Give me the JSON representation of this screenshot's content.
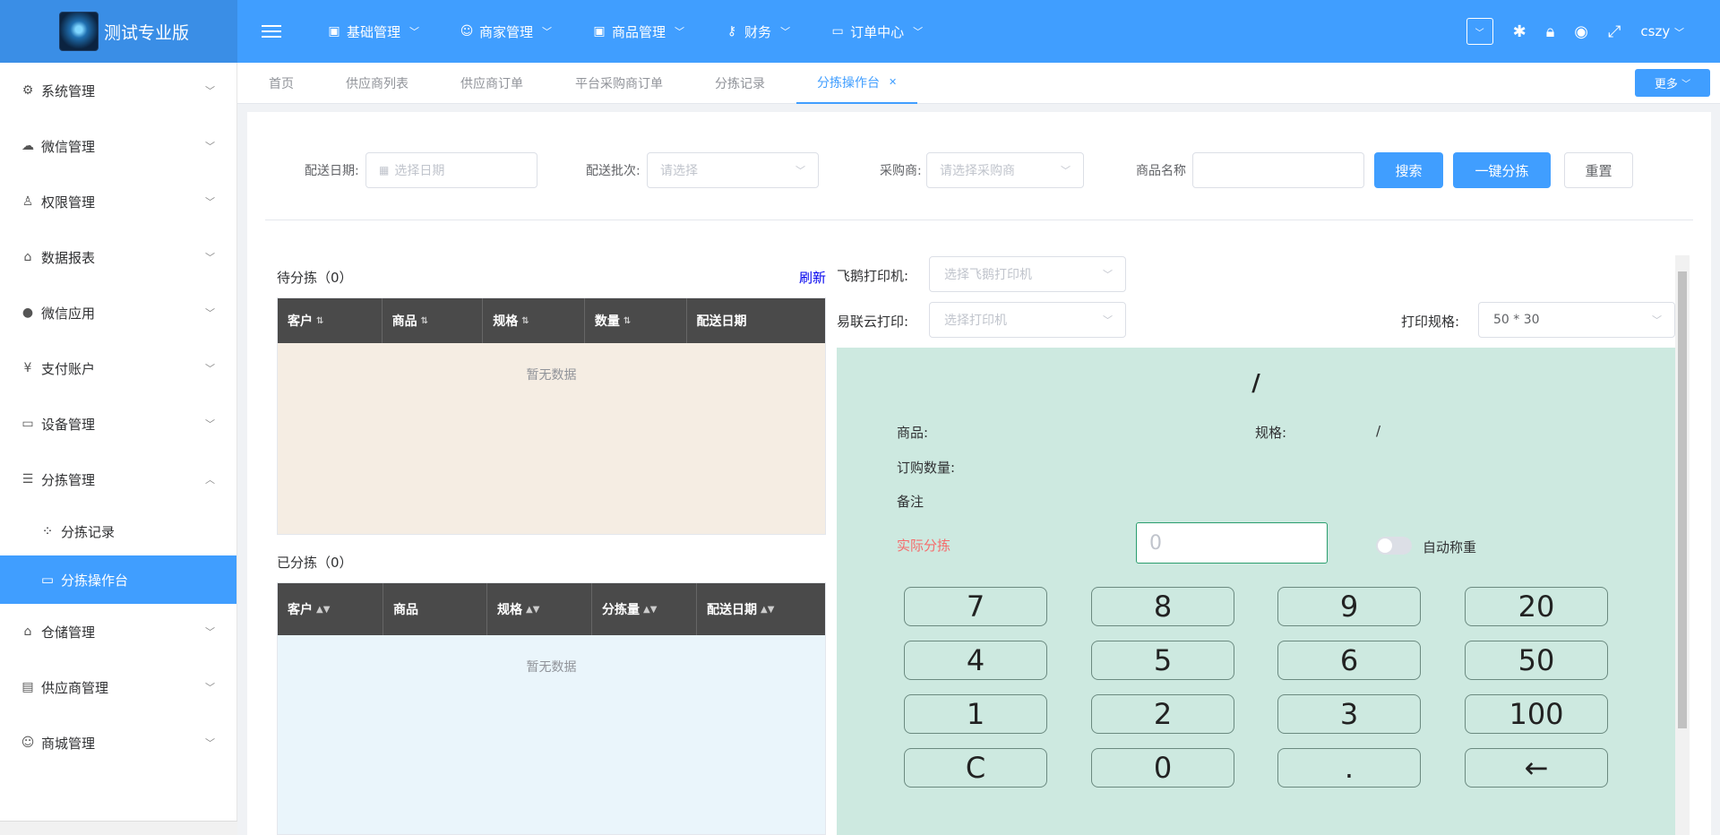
{
  "header": {
    "app_title": "测试专业版",
    "nav": [
      {
        "label": "基础管理",
        "icon": "monitor-icon"
      },
      {
        "label": "商家管理",
        "icon": "users-icon"
      },
      {
        "label": "商品管理",
        "icon": "box-icon"
      },
      {
        "label": "财务",
        "icon": "key-icon"
      },
      {
        "label": "订单中心",
        "icon": "screen-icon"
      }
    ],
    "user": "cszy"
  },
  "sidebar": {
    "items": [
      {
        "label": "系统管理",
        "icon": "gear-icon"
      },
      {
        "label": "微信管理",
        "icon": "wechat-icon"
      },
      {
        "label": "权限管理",
        "icon": "user-icon"
      },
      {
        "label": "数据报表",
        "icon": "home-icon"
      },
      {
        "label": "微信应用",
        "icon": "globe-icon"
      },
      {
        "label": "支付账户",
        "icon": "yen-icon"
      },
      {
        "label": "设备管理",
        "icon": "device-icon"
      },
      {
        "label": "分拣管理",
        "icon": "list-icon"
      }
    ],
    "sub_items": [
      {
        "label": "分拣记录",
        "icon": "dots-icon"
      },
      {
        "label": "分拣操作台",
        "icon": "monitor-icon"
      }
    ],
    "items_after": [
      {
        "label": "仓储管理",
        "icon": "home-icon"
      },
      {
        "label": "供应商管理",
        "icon": "clipboard-icon"
      },
      {
        "label": "商城管理",
        "icon": "users-icon"
      }
    ]
  },
  "tabs": [
    "首页",
    "供应商列表",
    "供应商订单",
    "平台采购商订单",
    "分拣记录",
    "分拣操作台"
  ],
  "more_label": "更多",
  "filters": {
    "date_label": "配送日期:",
    "date_placeholder": "选择日期",
    "batch_label": "配送批次:",
    "batch_placeholder": "请选择",
    "buyer_label": "采购商:",
    "buyer_placeholder": "请选择采购商",
    "product_label": "商品名称",
    "search_btn": "搜索",
    "one_click_btn": "一键分拣",
    "reset_btn": "重置"
  },
  "pending": {
    "title": "待分拣（0）",
    "refresh": "刷新",
    "columns": [
      "客户",
      "商品",
      "规格",
      "数量",
      "配送日期"
    ],
    "empty": "暂无数据"
  },
  "sorted": {
    "title": "已分拣（0）",
    "columns": [
      "客户",
      "商品",
      "规格",
      "分拣量",
      "配送日期"
    ],
    "empty": "暂无数据"
  },
  "printers": {
    "feie_label": "飞鹅打印机:",
    "feie_placeholder": "选择飞鹅打印机",
    "yilian_label": "易联云打印:",
    "yilian_placeholder": "选择打印机",
    "spec_label": "打印规格:",
    "spec_value": "50 * 30"
  },
  "station": {
    "title": "/",
    "product_label": "商品:",
    "spec_label": "规格:",
    "spec_value": "/",
    "qty_label": "订购数量:",
    "note_label": "备注",
    "actual_label": "实际分拣",
    "weight_placeholder": "0",
    "auto_weigh_label": "自动称重"
  },
  "keypad": [
    "7",
    "8",
    "9",
    "20",
    "4",
    "5",
    "6",
    "50",
    "1",
    "2",
    "3",
    "100",
    "C",
    "0",
    ".",
    "←"
  ]
}
